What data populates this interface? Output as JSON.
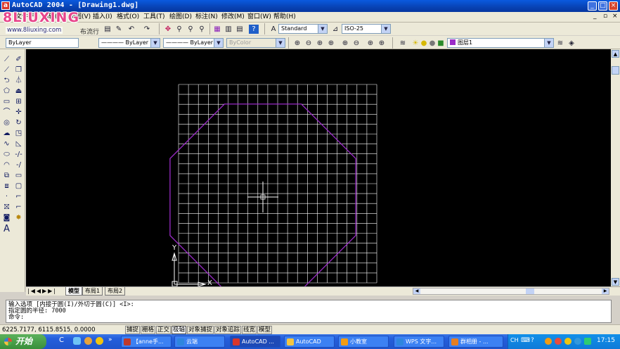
{
  "window": {
    "title": "AutoCAD 2004 - [Drawing1.dwg]",
    "app_icon": "autocad-icon",
    "controls": [
      "_",
      "□",
      "×"
    ],
    "doc_controls": [
      "_",
      "▫",
      "×"
    ]
  },
  "watermark": {
    "brand": "8LIUXING",
    "url": "www.8liuxing.com",
    "tagline": "布流行"
  },
  "menu": [
    {
      "label": "文件(F)"
    },
    {
      "label": "编辑(E)"
    },
    {
      "label": "视图(V)"
    },
    {
      "label": "插入(I)"
    },
    {
      "label": "格式(O)"
    },
    {
      "label": "工具(T)"
    },
    {
      "label": "绘图(D)"
    },
    {
      "label": "标注(N)"
    },
    {
      "label": "修改(M)"
    },
    {
      "label": "窗口(W)"
    },
    {
      "label": "帮助(H)"
    }
  ],
  "styles_toolbar": {
    "text_style": "Standard",
    "dim_style": "ISO-25"
  },
  "properties_toolbar": {
    "layer_prefix": "ByLayer",
    "color": "———— ByLayer",
    "linetype": "———— ByLayer",
    "lineweight": "ByColor",
    "layer_current": "图层1"
  },
  "canvas": {
    "grid_color": "#ffffff",
    "polygon_color": "#9a2bc7",
    "ucs_y": "Y",
    "ucs_x": "X",
    "polygon_sides": 8
  },
  "layout_tabs": [
    {
      "label": "模型",
      "active": true
    },
    {
      "label": "布局1",
      "active": false
    },
    {
      "label": "布局2",
      "active": false
    }
  ],
  "command": {
    "line1": "输入选项 [内接于圆(I)/外切于圆(C)] <I>:",
    "line2": "指定圆的半径: 7000",
    "line3": "命令:"
  },
  "status": {
    "coords": "6225.7177, 6115.8515, 0.0000",
    "toggles": [
      {
        "label": "捕捉",
        "on": false
      },
      {
        "label": "栅格",
        "on": false
      },
      {
        "label": "正交",
        "on": false
      },
      {
        "label": "极轴",
        "on": true
      },
      {
        "label": "对象捕捉",
        "on": false
      },
      {
        "label": "对象追踪",
        "on": false
      },
      {
        "label": "线宽",
        "on": false
      },
      {
        "label": "模型",
        "on": false
      }
    ]
  },
  "taskbar": {
    "start": "开始",
    "tasks": [
      {
        "label": "【anne手...",
        "color": "#c0392b",
        "active": false
      },
      {
        "label": "云端",
        "color": "#2e86de",
        "active": false
      },
      {
        "label": "AutoCAD ...",
        "color": "#d9362b",
        "active": true
      },
      {
        "label": "AutoCAD",
        "color": "#f4c542",
        "active": false
      },
      {
        "label": "小教室",
        "color": "#f39c12",
        "active": false
      },
      {
        "label": "WPS 文字...",
        "color": "#2e86de",
        "active": false
      },
      {
        "label": "群相册 - ...",
        "color": "#e67e22",
        "active": false
      }
    ],
    "tray_lang": "CH",
    "clock": "17:15"
  }
}
